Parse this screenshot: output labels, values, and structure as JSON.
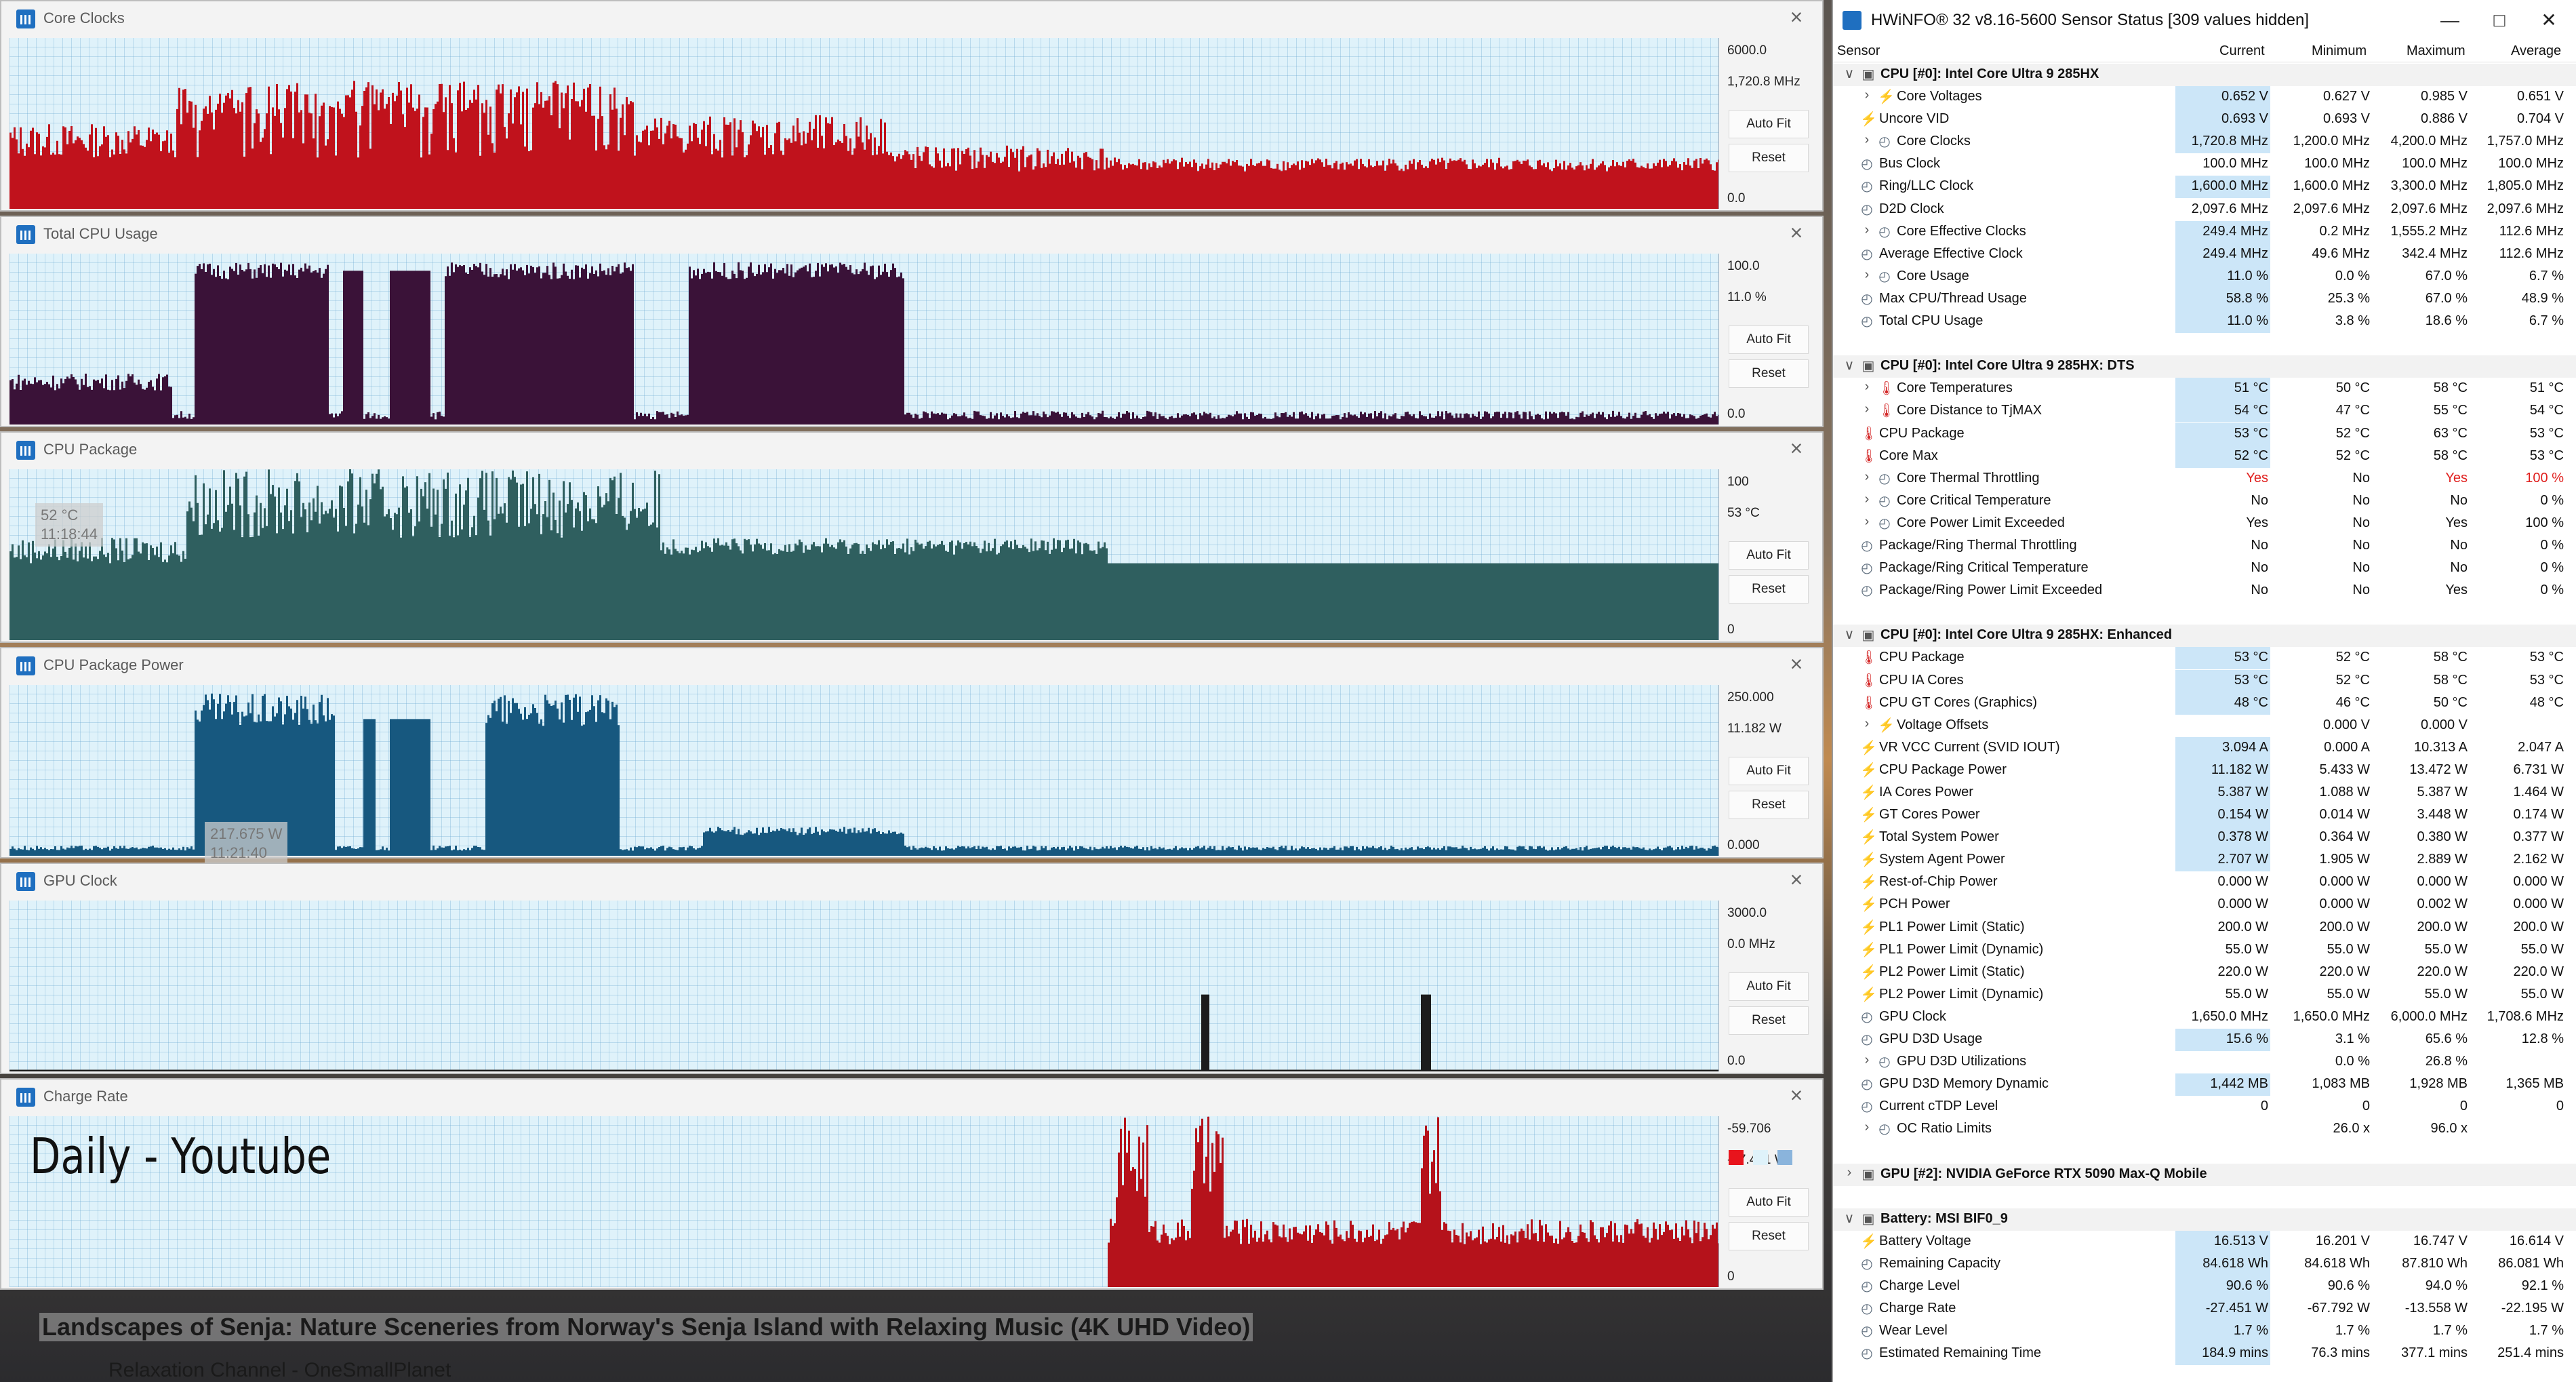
{
  "overlay_text": "Daily - Youtube",
  "video": {
    "title": "Landscapes of Senja: Nature Sceneries from Norway's Senja Island with Relaxing Music (4K UHD Video)",
    "channel": "Relaxation Channel - OneSmallPlanet"
  },
  "graphs": [
    {
      "title": "Core Clocks",
      "max": "6000.0",
      "current": "1,720.8 MHz",
      "min": "0.0",
      "color": "#c0121c"
    },
    {
      "title": "Total CPU Usage",
      "max": "100.0",
      "current": "11.0 %",
      "min": "0.0",
      "color": "#3a1238"
    },
    {
      "title": "CPU Package",
      "max": "100",
      "current": "53 °C",
      "min": "0",
      "color": "#2f5f5f",
      "tooltip_value": "52 °C",
      "tooltip_time": "11:18:44"
    },
    {
      "title": "CPU Package Power",
      "max": "250.000",
      "current": "11.182 W",
      "min": "0.000",
      "color": "#17587f",
      "tooltip_value": "217.675 W",
      "tooltip_time": "11:21:40"
    },
    {
      "title": "GPU Clock",
      "max": "3000.0",
      "current": "0.0 MHz",
      "min": "0.0",
      "color": "#1c1c1c"
    },
    {
      "title": "Charge Rate",
      "max": "-59.706",
      "current": "-27.451 W",
      "min": "0",
      "color": "#b5121b"
    }
  ],
  "buttons": {
    "auto_fit": "Auto Fit",
    "reset": "Reset"
  },
  "hwinfo": {
    "title": "HWiNFO® 32 v8.16-5600 Sensor Status [309 values hidden]",
    "columns": {
      "sensor": "Sensor",
      "current": "Current",
      "minimum": "Minimum",
      "maximum": "Maximum",
      "average": "Average"
    },
    "rows": [
      {
        "g": 1,
        "c": "v",
        "i": "gpu",
        "l": "CPU [#0]: Intel Core Ultra 9 285HX"
      },
      {
        "d": 1,
        "c": ">",
        "i": "bolt",
        "l": "Core Voltages",
        "v": [
          "0.652 V",
          "0.627 V",
          "0.985 V",
          "0.651 V"
        ],
        "h": 1
      },
      {
        "d": 0,
        "i": "bolt",
        "l": "Uncore VID",
        "v": [
          "0.693 V",
          "0.693 V",
          "0.886 V",
          "0.704 V"
        ],
        "h": 1
      },
      {
        "d": 1,
        "c": ">",
        "i": "clock",
        "l": "Core Clocks",
        "v": [
          "1,720.8 MHz",
          "1,200.0 MHz",
          "4,200.0 MHz",
          "1,757.0 MHz"
        ],
        "h": 1
      },
      {
        "d": 0,
        "i": "clock",
        "l": "Bus Clock",
        "v": [
          "100.0 MHz",
          "100.0 MHz",
          "100.0 MHz",
          "100.0 MHz"
        ]
      },
      {
        "d": 0,
        "i": "clock",
        "l": "Ring/LLC Clock",
        "v": [
          "1,600.0 MHz",
          "1,600.0 MHz",
          "3,300.0 MHz",
          "1,805.0 MHz"
        ],
        "h": 1
      },
      {
        "d": 0,
        "i": "clock",
        "l": "D2D Clock",
        "v": [
          "2,097.6 MHz",
          "2,097.6 MHz",
          "2,097.6 MHz",
          "2,097.6 MHz"
        ]
      },
      {
        "d": 1,
        "c": ">",
        "i": "clock",
        "l": "Core Effective Clocks",
        "v": [
          "249.4 MHz",
          "0.2 MHz",
          "1,555.2 MHz",
          "112.6 MHz"
        ],
        "h": 1
      },
      {
        "d": 0,
        "i": "clock",
        "l": "Average Effective Clock",
        "v": [
          "249.4 MHz",
          "49.6 MHz",
          "342.4 MHz",
          "112.6 MHz"
        ],
        "h": 1
      },
      {
        "d": 1,
        "c": ">",
        "i": "clock",
        "l": "Core Usage",
        "v": [
          "11.0 %",
          "0.0 %",
          "67.0 %",
          "6.7 %"
        ],
        "h": 1
      },
      {
        "d": 0,
        "i": "clock",
        "l": "Max CPU/Thread Usage",
        "v": [
          "58.8 %",
          "25.3 %",
          "67.0 %",
          "48.9 %"
        ],
        "h": 1
      },
      {
        "d": 0,
        "i": "clock",
        "l": "Total CPU Usage",
        "v": [
          "11.0 %",
          "3.8 %",
          "18.6 %",
          "6.7 %"
        ],
        "h": 1
      },
      {
        "blank": 1
      },
      {
        "g": 1,
        "c": "v",
        "i": "gpu",
        "l": "CPU [#0]: Intel Core Ultra 9 285HX: DTS"
      },
      {
        "d": 1,
        "c": ">",
        "i": "therm",
        "l": "Core Temperatures",
        "v": [
          "51 °C",
          "50 °C",
          "58 °C",
          "51 °C"
        ],
        "h": 1
      },
      {
        "d": 1,
        "c": ">",
        "i": "therm",
        "l": "Core Distance to TjMAX",
        "v": [
          "54 °C",
          "47 °C",
          "55 °C",
          "54 °C"
        ],
        "h": 1
      },
      {
        "d": 0,
        "i": "therm",
        "l": "CPU Package",
        "v": [
          "53 °C",
          "52 °C",
          "63 °C",
          "53 °C"
        ],
        "h": 1
      },
      {
        "d": 0,
        "i": "therm",
        "l": "Core Max",
        "v": [
          "52 °C",
          "52 °C",
          "58 °C",
          "53 °C"
        ],
        "h": 1
      },
      {
        "d": 1,
        "c": ">",
        "i": "clock",
        "l": "Core Thermal Throttling",
        "v": [
          "Yes",
          "No",
          "Yes",
          "100 %"
        ],
        "red": 1
      },
      {
        "d": 1,
        "c": ">",
        "i": "clock",
        "l": "Core Critical Temperature",
        "v": [
          "No",
          "No",
          "No",
          "0 %"
        ]
      },
      {
        "d": 1,
        "c": ">",
        "i": "clock",
        "l": "Core Power Limit Exceeded",
        "v": [
          "Yes",
          "No",
          "Yes",
          "100 %"
        ]
      },
      {
        "d": 0,
        "i": "clock",
        "l": "Package/Ring Thermal Throttling",
        "v": [
          "No",
          "No",
          "No",
          "0 %"
        ]
      },
      {
        "d": 0,
        "i": "clock",
        "l": "Package/Ring Critical Temperature",
        "v": [
          "No",
          "No",
          "No",
          "0 %"
        ]
      },
      {
        "d": 0,
        "i": "clock",
        "l": "Package/Ring Power Limit Exceeded",
        "v": [
          "No",
          "No",
          "Yes",
          "0 %"
        ]
      },
      {
        "blank": 1
      },
      {
        "g": 1,
        "c": "v",
        "i": "gpu",
        "l": "CPU [#0]: Intel Core Ultra 9 285HX: Enhanced"
      },
      {
        "d": 0,
        "i": "therm",
        "l": "CPU Package",
        "v": [
          "53 °C",
          "52 °C",
          "58 °C",
          "53 °C"
        ],
        "h": 1
      },
      {
        "d": 0,
        "i": "therm",
        "l": "CPU IA Cores",
        "v": [
          "53 °C",
          "52 °C",
          "58 °C",
          "53 °C"
        ],
        "h": 1
      },
      {
        "d": 0,
        "i": "therm",
        "l": "CPU GT Cores (Graphics)",
        "v": [
          "48 °C",
          "46 °C",
          "50 °C",
          "48 °C"
        ],
        "h": 1
      },
      {
        "d": 1,
        "c": ">",
        "i": "bolt",
        "l": "Voltage Offsets",
        "v": [
          "",
          "0.000 V",
          "0.000 V",
          ""
        ]
      },
      {
        "d": 0,
        "i": "bolt",
        "l": "VR VCC Current (SVID IOUT)",
        "v": [
          "3.094 A",
          "0.000 A",
          "10.313 A",
          "2.047 A"
        ],
        "h": 1
      },
      {
        "d": 0,
        "i": "bolt",
        "l": "CPU Package Power",
        "v": [
          "11.182 W",
          "5.433 W",
          "13.472 W",
          "6.731 W"
        ],
        "h": 1
      },
      {
        "d": 0,
        "i": "bolt",
        "l": "IA Cores Power",
        "v": [
          "5.387 W",
          "1.088 W",
          "5.387 W",
          "1.464 W"
        ],
        "h": 1
      },
      {
        "d": 0,
        "i": "bolt",
        "l": "GT Cores Power",
        "v": [
          "0.154 W",
          "0.014 W",
          "3.448 W",
          "0.174 W"
        ],
        "h": 1
      },
      {
        "d": 0,
        "i": "bolt",
        "l": "Total System Power",
        "v": [
          "0.378 W",
          "0.364 W",
          "0.380 W",
          "0.377 W"
        ],
        "h": 1
      },
      {
        "d": 0,
        "i": "bolt",
        "l": "System Agent Power",
        "v": [
          "2.707 W",
          "1.905 W",
          "2.889 W",
          "2.162 W"
        ],
        "h": 1
      },
      {
        "d": 0,
        "i": "bolt",
        "l": "Rest-of-Chip Power",
        "v": [
          "0.000 W",
          "0.000 W",
          "0.000 W",
          "0.000 W"
        ]
      },
      {
        "d": 0,
        "i": "bolt",
        "l": "PCH Power",
        "v": [
          "0.000 W",
          "0.000 W",
          "0.002 W",
          "0.000 W"
        ]
      },
      {
        "d": 0,
        "i": "bolt",
        "l": "PL1 Power Limit (Static)",
        "v": [
          "200.0 W",
          "200.0 W",
          "200.0 W",
          "200.0 W"
        ]
      },
      {
        "d": 0,
        "i": "bolt",
        "l": "PL1 Power Limit (Dynamic)",
        "v": [
          "55.0 W",
          "55.0 W",
          "55.0 W",
          "55.0 W"
        ]
      },
      {
        "d": 0,
        "i": "bolt",
        "l": "PL2 Power Limit (Static)",
        "v": [
          "220.0 W",
          "220.0 W",
          "220.0 W",
          "220.0 W"
        ]
      },
      {
        "d": 0,
        "i": "bolt",
        "l": "PL2 Power Limit (Dynamic)",
        "v": [
          "55.0 W",
          "55.0 W",
          "55.0 W",
          "55.0 W"
        ]
      },
      {
        "d": 0,
        "i": "clock",
        "l": "GPU Clock",
        "v": [
          "1,650.0 MHz",
          "1,650.0 MHz",
          "6,000.0 MHz",
          "1,708.6 MHz"
        ]
      },
      {
        "d": 0,
        "i": "clock",
        "l": "GPU D3D Usage",
        "v": [
          "15.6 %",
          "3.1 %",
          "65.6 %",
          "12.8 %"
        ],
        "h": 1
      },
      {
        "d": 1,
        "c": ">",
        "i": "clock",
        "l": "GPU D3D Utilizations",
        "v": [
          "",
          "0.0 %",
          "26.8 %",
          ""
        ]
      },
      {
        "d": 0,
        "i": "clock",
        "l": "GPU D3D Memory Dynamic",
        "v": [
          "1,442 MB",
          "1,083 MB",
          "1,928 MB",
          "1,365 MB"
        ],
        "h": 1
      },
      {
        "d": 0,
        "i": "clock",
        "l": "Current cTDP Level",
        "v": [
          "0",
          "0",
          "0",
          "0"
        ]
      },
      {
        "d": 1,
        "c": ">",
        "i": "clock",
        "l": "OC Ratio Limits",
        "v": [
          "",
          "26.0 x",
          "96.0 x",
          ""
        ]
      },
      {
        "blank": 1
      },
      {
        "g": 1,
        "c": ">",
        "i": "gpu",
        "l": "GPU [#2]: NVIDIA  GeForce RTX 5090 Max-Q Mobile"
      },
      {
        "blank": 1
      },
      {
        "g": 1,
        "c": "v",
        "i": "gpu",
        "l": "Battery: MSI BIF0_9"
      },
      {
        "d": 0,
        "i": "bolt",
        "l": "Battery Voltage",
        "v": [
          "16.513 V",
          "16.201 V",
          "16.747 V",
          "16.614 V"
        ],
        "h": 1
      },
      {
        "d": 0,
        "i": "clock",
        "l": "Remaining Capacity",
        "v": [
          "84.618 Wh",
          "84.618 Wh",
          "87.810 Wh",
          "86.081 Wh"
        ],
        "h": 1
      },
      {
        "d": 0,
        "i": "clock",
        "l": "Charge Level",
        "v": [
          "90.6 %",
          "90.6 %",
          "94.0 %",
          "92.1 %"
        ],
        "h": 1
      },
      {
        "d": 0,
        "i": "clock",
        "l": "Charge Rate",
        "v": [
          "-27.451 W",
          "-67.792 W",
          "-13.558 W",
          "-22.195 W"
        ],
        "h": 1
      },
      {
        "d": 0,
        "i": "clock",
        "l": "Wear Level",
        "v": [
          "1.7 %",
          "1.7 %",
          "1.7 %",
          "1.7 %"
        ],
        "h": 1
      },
      {
        "d": 0,
        "i": "clock",
        "l": "Estimated Remaining Time",
        "v": [
          "184.9 mins",
          "76.3 mins",
          "377.1 mins",
          "251.4 mins"
        ],
        "h": 1
      }
    ]
  }
}
